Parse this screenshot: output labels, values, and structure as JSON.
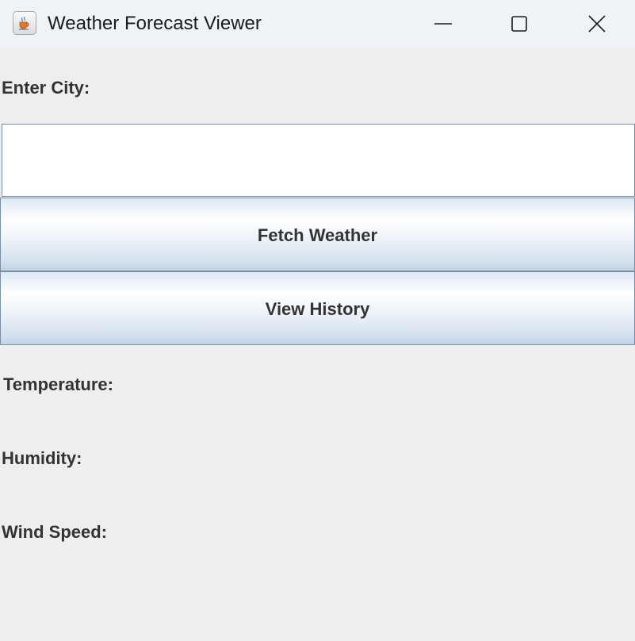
{
  "window": {
    "title": "Weather Forecast Viewer",
    "app_icon": "java-coffee-cup-icon",
    "controls": {
      "minimize_icon": "minimize-icon",
      "maximize_icon": "maximize-icon",
      "close_icon": "close-icon"
    }
  },
  "form": {
    "city_label": "Enter City:",
    "city_value": "",
    "city_placeholder": "",
    "fetch_button_label": "Fetch Weather",
    "history_button_label": "View History"
  },
  "results": {
    "temperature_label": "Temperature:",
    "humidity_label": "Humidity:",
    "wind_speed_label": "Wind Speed:"
  },
  "colors": {
    "background": "#eeeeee",
    "titlebar": "#eff3f8",
    "button_border": "#7a8ea6",
    "label_text": "#333333"
  }
}
